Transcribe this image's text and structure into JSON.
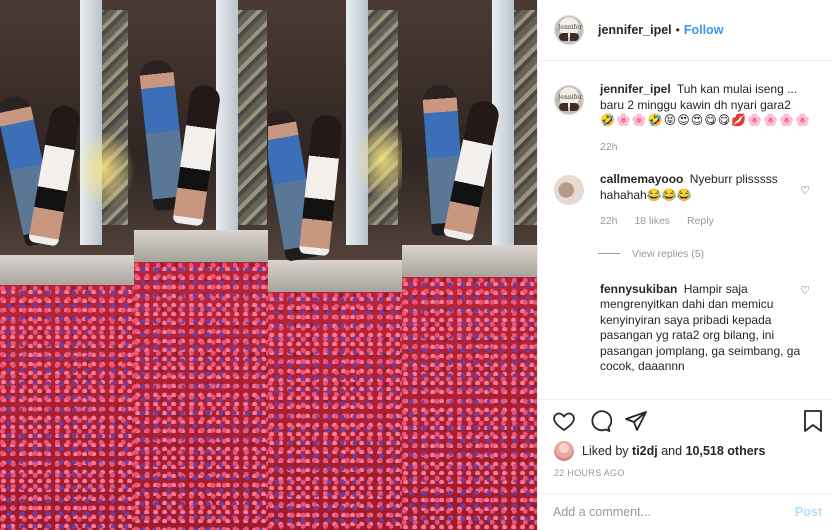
{
  "header": {
    "username": "jennifer_ipel",
    "separator": "•",
    "follow_label": "Follow"
  },
  "comments": [
    {
      "username": "jennifer_ipel",
      "text": "Tuh kan mulai iseng ... baru 2 minggu kawin dh nyari gara2",
      "emojis": "🤣🌸🌸🤣😝😍😍😋😋💋🌸🌸🌸🌸",
      "time": "22h"
    },
    {
      "username": "callmemayooo",
      "text": "Nyeburr plisssss hahahah😂😂😂",
      "time": "22h",
      "likes": "18 likes",
      "reply_label": "Reply",
      "view_replies": "View replies (5)"
    },
    {
      "username": "fennysukiban",
      "text": "Hampir saja mengrenyitkan dahi dan memicu kenyinyiran saya pribadi kepada pasangan yg rata2 org bilang, ini pasangan jomplang, ga seimbang, ga cocok, daaannn"
    }
  ],
  "likes": {
    "prefix": "Liked by",
    "user": "ti2dj",
    "connector": "and",
    "others": "10,518 others"
  },
  "timestamp": "22 HOURS AGO",
  "add_comment": {
    "placeholder": "Add a comment...",
    "post_label": "Post"
  },
  "colors": {
    "accent": "#3897f0",
    "post_disabled": "#b2dffc",
    "muted": "#999999",
    "border": "#efefef"
  },
  "icons": [
    "heart-icon",
    "comment-icon",
    "share-icon",
    "bookmark-icon"
  ]
}
